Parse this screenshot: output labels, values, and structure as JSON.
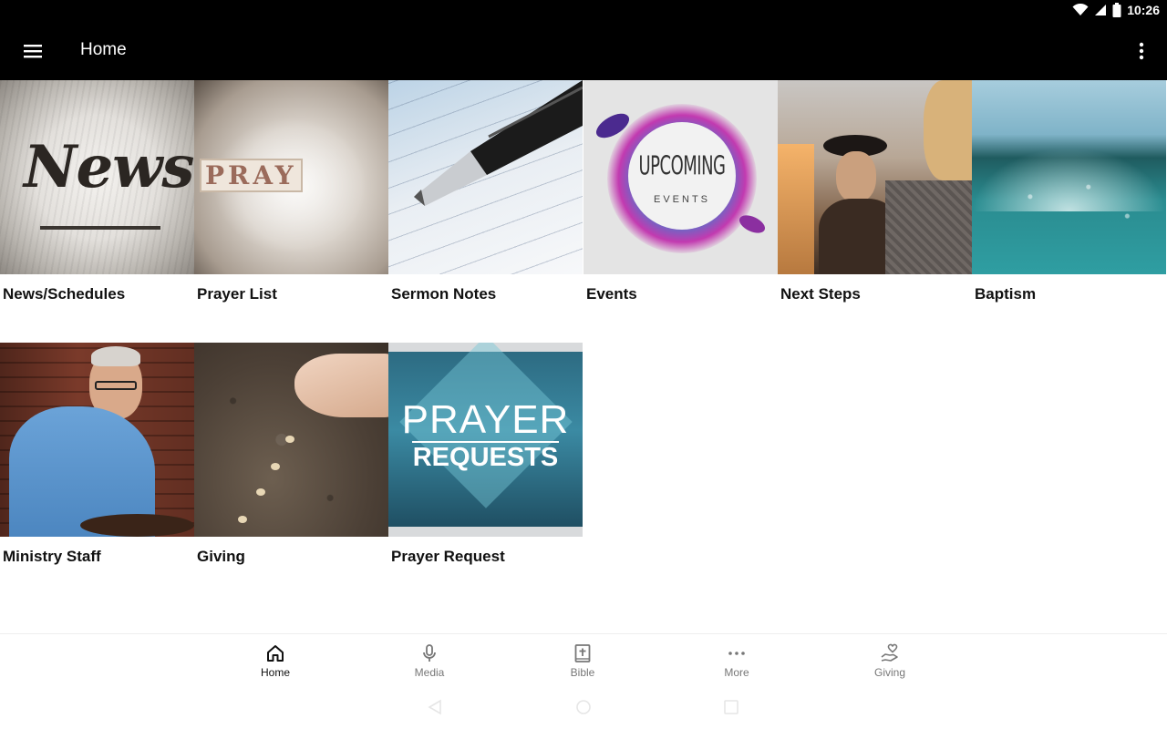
{
  "status_bar": {
    "time": "10:26"
  },
  "app_bar": {
    "title": "Home"
  },
  "tiles": [
    {
      "label": "News/Schedules",
      "image_text": "News"
    },
    {
      "label": "Prayer List",
      "image_text": "PRAY"
    },
    {
      "label": "Sermon Notes"
    },
    {
      "label": "Events",
      "image_text": "UPCOMING",
      "image_subtext": "EVENTS"
    },
    {
      "label": "Next Steps"
    },
    {
      "label": "Baptism"
    },
    {
      "label": "Ministry Staff"
    },
    {
      "label": "Giving"
    },
    {
      "label": "Prayer Request",
      "image_text": "PRAYER",
      "image_subtext": "REQUESTS"
    }
  ],
  "bottom_nav": {
    "items": [
      {
        "label": "Home",
        "icon": "home-icon",
        "active": true
      },
      {
        "label": "Media",
        "icon": "microphone-icon"
      },
      {
        "label": "Bible",
        "icon": "bible-icon"
      },
      {
        "label": "More",
        "icon": "more-dots-icon"
      },
      {
        "label": "Giving",
        "icon": "giving-heart-hand-icon"
      }
    ]
  },
  "colors": {
    "app_bar": "#000000",
    "active_nav": "#111111",
    "inactive_nav": "#777777"
  }
}
